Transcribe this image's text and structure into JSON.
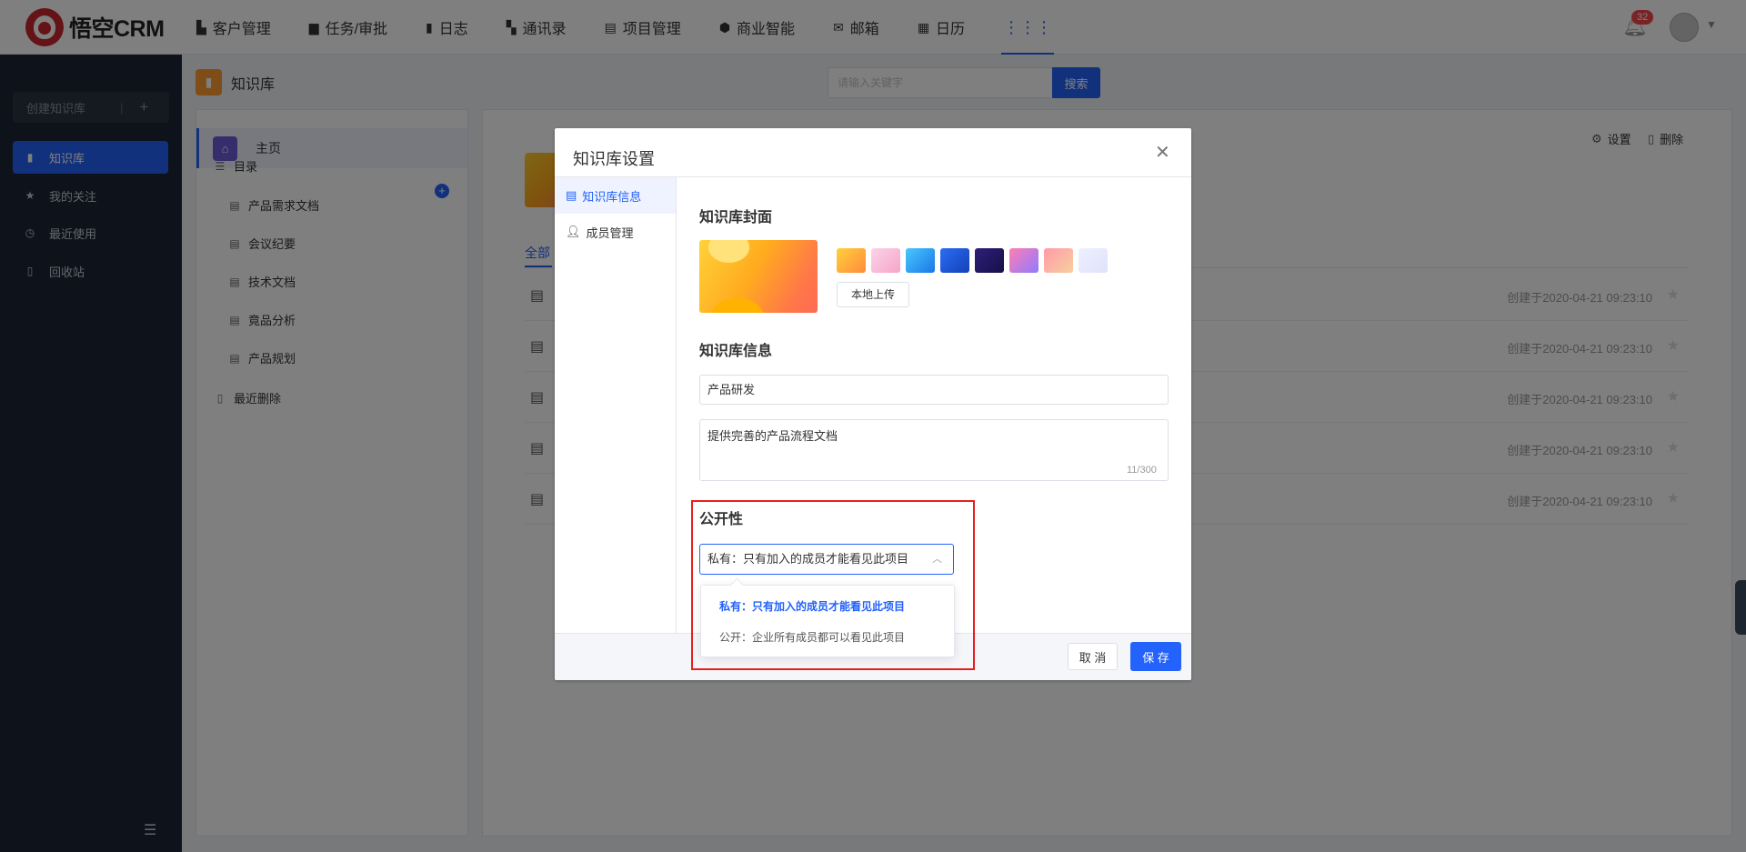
{
  "app": {
    "name": "悟空CRM"
  },
  "topnav": {
    "items": [
      {
        "label": "客户管理",
        "icon": "building-icon"
      },
      {
        "label": "任务/审批",
        "icon": "briefcase-icon"
      },
      {
        "label": "日志",
        "icon": "log-icon"
      },
      {
        "label": "通讯录",
        "icon": "contacts-icon"
      },
      {
        "label": "项目管理",
        "icon": "project-icon"
      },
      {
        "label": "商业智能",
        "icon": "bi-icon"
      },
      {
        "label": "邮箱",
        "icon": "mail-icon"
      },
      {
        "label": "日历",
        "icon": "calendar-icon"
      }
    ],
    "notification_count": "32"
  },
  "sidebar": {
    "create_label": "创建知识库",
    "items": [
      {
        "label": "知识库",
        "icon": "book-icon",
        "active": true
      },
      {
        "label": "我的关注",
        "icon": "star-icon"
      },
      {
        "label": "最近使用",
        "icon": "clock-icon"
      },
      {
        "label": "回收站",
        "icon": "trash-icon"
      }
    ]
  },
  "page": {
    "title": "知识库",
    "search_placeholder": "请输入关键字",
    "search_button": "搜索"
  },
  "tree": {
    "home_label": "主页",
    "catalog_label": "目录",
    "docs": [
      "产品需求文档",
      "会议纪要",
      "技术文档",
      "竟品分析",
      "产品规划"
    ],
    "recent_delete_label": "最近删除"
  },
  "main": {
    "tab_partial": "全部",
    "settings_label": "设置",
    "delete_label": "删除",
    "rows": [
      {
        "date": "创建于2020-04-21 09:23:10"
      },
      {
        "date": "创建于2020-04-21 09:23:10"
      },
      {
        "date": "创建于2020-04-21 09:23:10"
      },
      {
        "date": "创建于2020-04-21 09:23:10"
      },
      {
        "date": "创建于2020-04-21 09:23:10"
      }
    ]
  },
  "dialog": {
    "title": "知识库设置",
    "nav": [
      {
        "label": "知识库信息",
        "active": true
      },
      {
        "label": "成员管理"
      }
    ],
    "cover_title": "知识库封面",
    "upload_label": "本地上传",
    "info_title": "知识库信息",
    "name_value": "产品研发",
    "desc_value": "提供完善的产品流程文档",
    "desc_count": "11/300",
    "public_title": "公开性",
    "public_value": "私有：只有加入的成员才能看见此项目",
    "public_options": [
      "私有：只有加入的成员才能看见此项目",
      "公开：企业所有成员都可以看见此项目"
    ],
    "cancel_label": "取 消",
    "save_label": "保 存"
  },
  "colors": {
    "primary": "#2362fb",
    "sidebar_bg": "#1d2636",
    "highlight_border": "#e81e1e"
  }
}
